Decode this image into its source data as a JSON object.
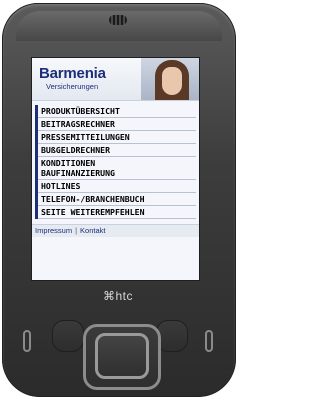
{
  "device": {
    "brand": "htc"
  },
  "header": {
    "brand": "Barmenia",
    "subtitle": "Versicherungen"
  },
  "menu": [
    "PRODUKTÜBERSICHT",
    "BEITRAGSRECHNER",
    "PRESSEMITTEILUNGEN",
    "BUßGELDRECHNER",
    "KONDITIONEN",
    "BAUFINANZIERUNG",
    "HOTLINES",
    "TELEFON-/BRANCHENBUCH",
    "SEITE WEITEREMPFEHLEN"
  ],
  "footer": {
    "impressum": "Impressum",
    "separator": "|",
    "kontakt": "Kontakt"
  }
}
